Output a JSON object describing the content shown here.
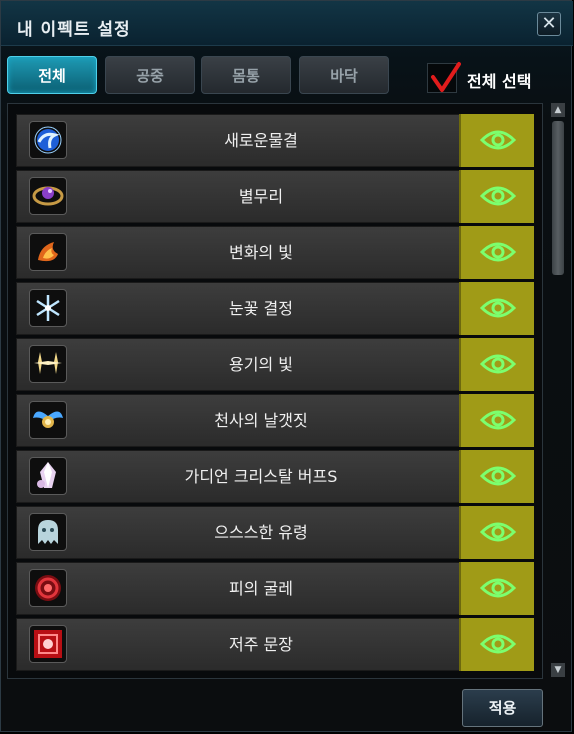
{
  "window": {
    "title": "내 이펙트 설정",
    "close_label": "✕"
  },
  "tabs": [
    {
      "label": "전체",
      "active": true
    },
    {
      "label": "공중",
      "active": false
    },
    {
      "label": "몸통",
      "active": false
    },
    {
      "label": "바닥",
      "active": false
    }
  ],
  "select_all": {
    "label": "전체 선택",
    "checked": true
  },
  "effects": [
    {
      "name": "새로운물결",
      "icon": "water-wave-icon",
      "visible": true
    },
    {
      "name": "별무리",
      "icon": "star-cluster-icon",
      "visible": true
    },
    {
      "name": "변화의 빛",
      "icon": "flame-light-icon",
      "visible": true
    },
    {
      "name": "눈꽃 결정",
      "icon": "snowflake-icon",
      "visible": true
    },
    {
      "name": "용기의 빛",
      "icon": "sparkle-light-icon",
      "visible": true
    },
    {
      "name": "천사의 날갯짓",
      "icon": "angel-wing-icon",
      "visible": true
    },
    {
      "name": "가디언 크리스탈 버프S",
      "icon": "guardian-crystal-icon",
      "visible": true
    },
    {
      "name": "으스스한 유령",
      "icon": "ghost-icon",
      "visible": true
    },
    {
      "name": "피의 굴레",
      "icon": "blood-ring-icon",
      "visible": true
    },
    {
      "name": "저주 문장",
      "icon": "curse-seal-icon",
      "visible": true
    }
  ],
  "apply_label": "적용",
  "colors": {
    "accent_tab": "#1e9ab4",
    "visibility_cell": "#a09b17",
    "eye_icon": "#7cff6e",
    "check_mark": "#e21c1c"
  }
}
